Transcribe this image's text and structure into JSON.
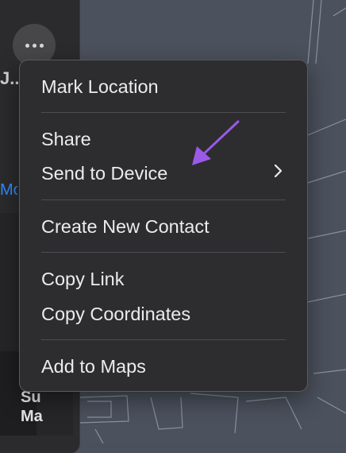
{
  "panel": {
    "title": "J...",
    "link_text": "Mo",
    "subtitle_line1": "Su",
    "subtitle_line2": "Ma",
    "more_icon": "ellipsis-icon"
  },
  "menu": {
    "items": [
      {
        "label": "Mark Location"
      },
      {
        "label": "Share"
      },
      {
        "label": "Send to Device",
        "submenu_icon": "chevron-right-icon"
      },
      {
        "label": "Create New Contact"
      },
      {
        "label": "Copy Link"
      },
      {
        "label": "Copy Coordinates"
      },
      {
        "label": "Add to Maps"
      }
    ]
  },
  "annotation": {
    "icon": "arrow-icon",
    "color": "#9b59e8"
  },
  "colors": {
    "menu_bg": "#2d2d30",
    "map_bg": "#4b515d",
    "link": "#2f8cff"
  }
}
